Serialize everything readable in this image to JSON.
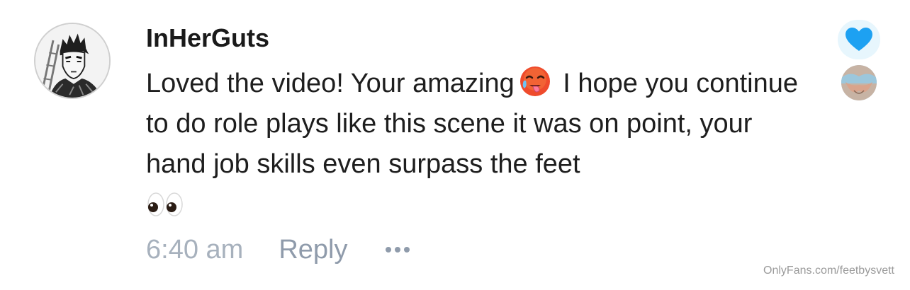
{
  "comment": {
    "username": "InHerGuts",
    "text_part1": "Loved the video! Your amazing",
    "text_emoji_1": "hot-face-emoji",
    "text_part2": "I hope you continue to do role plays like this scene it was on point, your hand job skills even surpass the feet",
    "text_emoji_2": "eyes-emoji",
    "timestamp": "6:40 am",
    "reply_label": "Reply",
    "more_icon": "more-dots-icon",
    "avatar_icon": "user-avatar-manga"
  },
  "like": {
    "icon": "heart-icon",
    "liked": true,
    "color": "#1da1f2"
  },
  "watermark": "OnlyFans.com/feetbysvett",
  "colors": {
    "username": "#1a1a1a",
    "text": "#1e1e1e",
    "timestamp": "#a7b1bd",
    "reply": "#8f9bab",
    "like_bg": "#e7f6fd"
  }
}
